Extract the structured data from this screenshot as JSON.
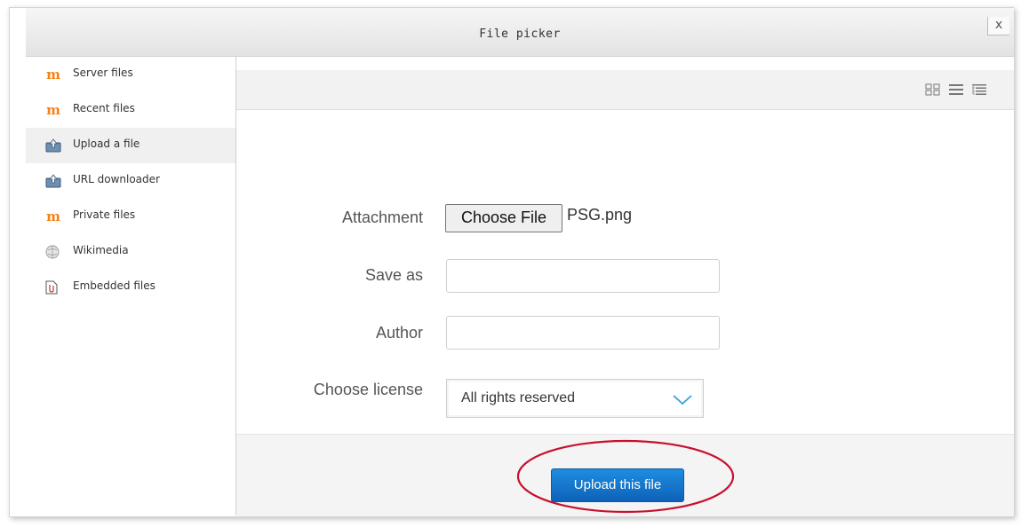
{
  "dialog": {
    "title": "File picker",
    "close_label": "x"
  },
  "sidebar": {
    "items": [
      {
        "label": "Server files",
        "icon": "moodle-icon"
      },
      {
        "label": "Recent files",
        "icon": "moodle-icon"
      },
      {
        "label": "Upload a file",
        "icon": "upload-icon",
        "active": true
      },
      {
        "label": "URL downloader",
        "icon": "upload-icon"
      },
      {
        "label": "Private files",
        "icon": "moodle-icon"
      },
      {
        "label": "Wikimedia",
        "icon": "wikimedia-icon"
      },
      {
        "label": "Embedded files",
        "icon": "embedded-file-icon"
      }
    ]
  },
  "toolbar": {
    "views": [
      "icons-view-icon",
      "list-view-icon",
      "tree-view-icon"
    ]
  },
  "form": {
    "attachment_label": "Attachment",
    "choose_file_label": "Choose File",
    "selected_file": "PSG.png",
    "save_as_label": "Save as",
    "save_as_value": "",
    "author_label": "Author",
    "author_value": "",
    "license_label": "Choose license",
    "license_value": "All rights reserved"
  },
  "footer": {
    "upload_label": "Upload this file"
  },
  "colors": {
    "accent": "#1a7fd6",
    "highlight": "#c8102e",
    "moodle": "#f98012"
  }
}
